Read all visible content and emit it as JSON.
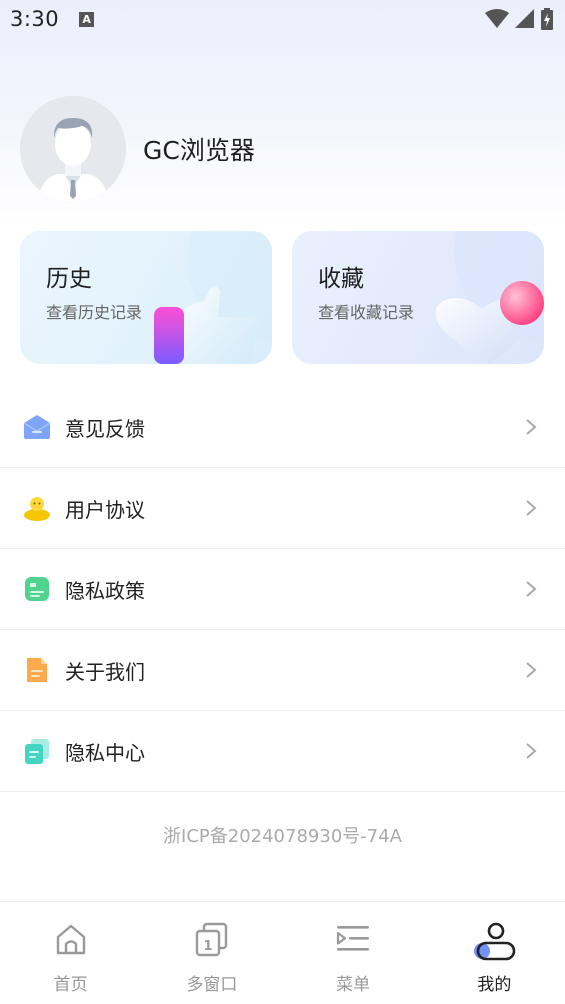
{
  "status_bar": {
    "time": "3:30",
    "notif_letter": "A"
  },
  "profile": {
    "app_name": "GC浏览器"
  },
  "cards": [
    {
      "title": "历史",
      "subtitle": "查看历史记录"
    },
    {
      "title": "收藏",
      "subtitle": "查看收藏记录"
    }
  ],
  "menu": [
    {
      "label": "意见反馈",
      "icon": "feedback-icon"
    },
    {
      "label": "用户协议",
      "icon": "user-agreement-icon"
    },
    {
      "label": "隐私政策",
      "icon": "privacy-policy-icon"
    },
    {
      "label": "关于我们",
      "icon": "about-us-icon"
    },
    {
      "label": "隐私中心",
      "icon": "privacy-center-icon"
    }
  ],
  "icp": "浙ICP备2024078930号-74A",
  "tabs": [
    {
      "label": "首页",
      "icon": "home-icon",
      "active": false
    },
    {
      "label": "多窗口",
      "icon": "multi-window-icon",
      "active": false
    },
    {
      "label": "菜单",
      "icon": "menu-icon",
      "active": false
    },
    {
      "label": "我的",
      "icon": "profile-icon",
      "active": true
    }
  ],
  "colors": {
    "accent": "#5b7cf2",
    "text": "#222222",
    "muted": "#999999"
  }
}
